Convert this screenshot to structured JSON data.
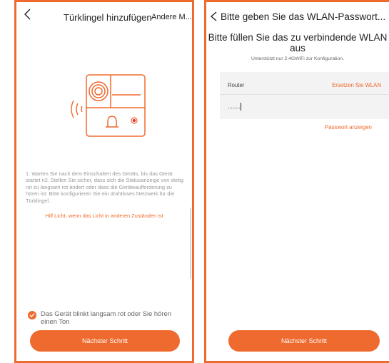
{
  "colors": {
    "accent": "#ef6a2e",
    "card": "#f3f3f3"
  },
  "left": {
    "header": {
      "title": "Türklingel hinzufügen",
      "action": "Andere M..."
    },
    "instructions": "1. Warten Sie nach dem Einschalten des Geräts, bis das Gerät startet  n2. Stellen Sie sicher, dass sich die Statusanzeige von stetig rot zu langsam rot ändert oder dass die Geräteaufforderung zu hören ist: Bitte konfigurieren Sie ein drahtloses Netzwerk für die Türklingel.",
    "help_link": "Hilf Licht, wenn das Licht in anderen Zuständen ist",
    "confirm": "Das Gerät blinkt langsam rot oder Sie hören einen Ton",
    "next_button": "Nächster Schritt"
  },
  "right": {
    "header": {
      "title": "Bitte geben Sie das WLAN-Passwort..."
    },
    "heading": "Bitte füllen Sie das zu verbindende WLAN aus",
    "subtitle": "Unterstützt nur 2.4GWiFi zur Konfiguration.",
    "router_label": "Router",
    "replace_link": "Ersetzen Sie WLAN",
    "password_value": "········",
    "show_password": "Passwort anzeigen",
    "next_button": "Nächster Schritt"
  }
}
